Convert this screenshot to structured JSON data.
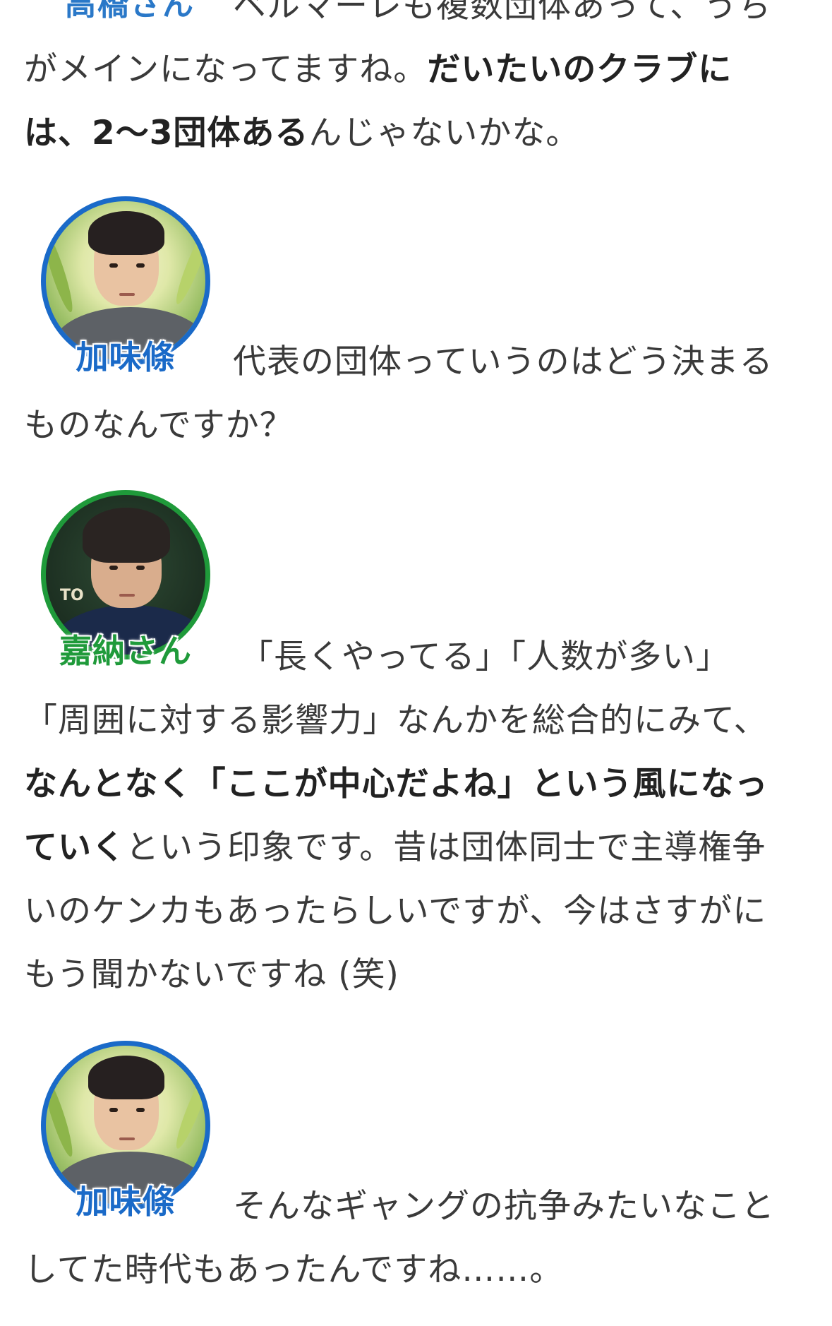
{
  "cut_top": {
    "speaker": "高橋さん",
    "line1": "ベルマーレも複数団体あって、うち",
    "line2": "がメインになってますね。",
    "line2_bold": "だいたいのクラブに",
    "line3_bold": "は、2〜3団体ある",
    "line3_rest": "んじゃないかな。"
  },
  "block1": {
    "speaker": "加味條",
    "line1": "代表の団体っていうのはどう決まる",
    "line2": "ものなんですか？"
  },
  "block2": {
    "speaker": "嘉納さん",
    "logo_text": "TO",
    "line1": "「長くやってる」「人数が多い」",
    "line2": "「周囲に対する影響力」なんかを総合的にみて、",
    "line3_bold": "なんとなく「ここが中心だよね」という風になっ",
    "line4_bold": "ていく",
    "line4_rest": "という印象です。昔は団体同士で主導権争",
    "line5": "いのケンカもあったらしいですが、今はさすがに",
    "line6": "もう聞かないですね (笑)"
  },
  "block3": {
    "speaker": "加味條",
    "line1": "そんなギャングの抗争みたいなこと",
    "line2": "してた時代もあったんですね……。"
  },
  "colors": {
    "blue_speaker": "#1a6ac8",
    "green_speaker": "#1f9a3a",
    "text": "#3a3a3a"
  }
}
